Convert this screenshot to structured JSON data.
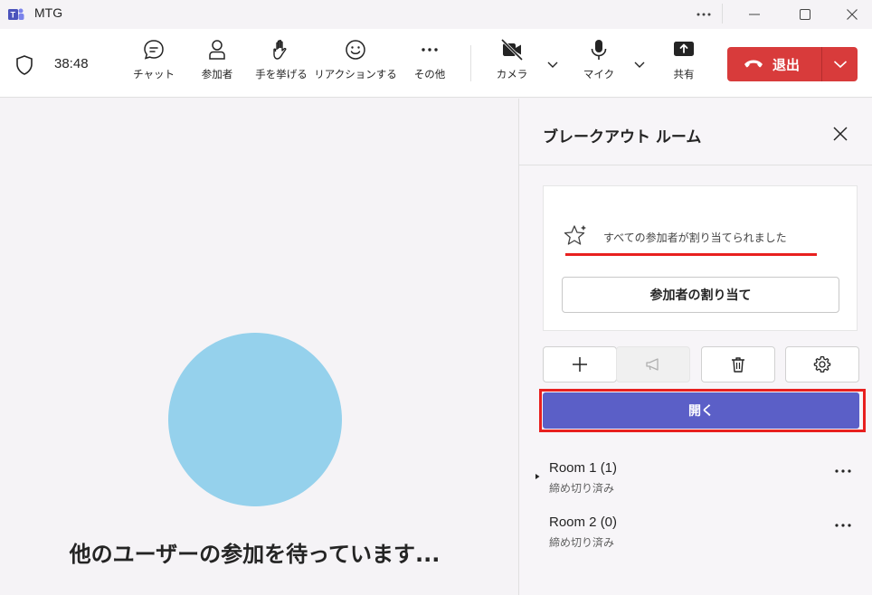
{
  "window": {
    "title": "MTG"
  },
  "toolbar": {
    "timer": "38:48",
    "chat": "チャット",
    "participants": "参加者",
    "raise_hand": "手を挙げる",
    "reaction": "リアクションする",
    "more": "その他",
    "camera": "カメラ",
    "mic": "マイク",
    "share": "共有",
    "leave": "退出",
    "leave_color": "#d83b3b"
  },
  "stage": {
    "waiting_text": "他のユーザーの参加を待っています...",
    "avatar_color": "#95d1ec"
  },
  "panel": {
    "title": "ブレークアウト ルーム",
    "assigned_message": "すべての参加者が割り当てられました",
    "assign_button": "参加者の割り当て",
    "open_button": "開く",
    "accent_color": "#5b5fc7",
    "rooms": [
      {
        "name": "Room 1  (1)",
        "status": "締め切り済み"
      },
      {
        "name": "Room 2  (0)",
        "status": "締め切り済み"
      }
    ]
  }
}
